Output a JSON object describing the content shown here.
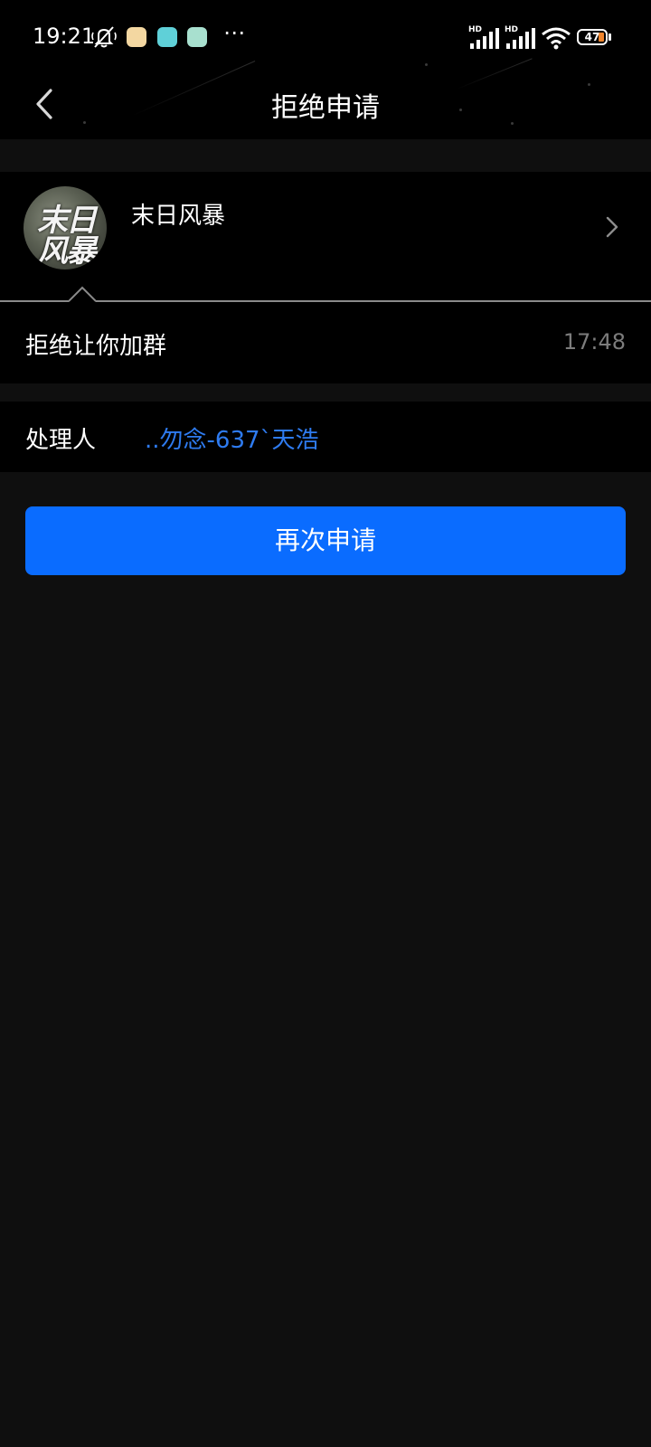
{
  "status_bar": {
    "time": "19:21",
    "hd_label": "HD",
    "battery_level": "47",
    "icons": [
      "mute-icon",
      "app-notification-icon",
      "app-notification-icon",
      "app-notification-icon",
      "more-icon",
      "signal-icon",
      "signal-icon",
      "wifi-icon",
      "battery-icon"
    ]
  },
  "nav": {
    "title": "拒绝申请",
    "back_icon": "chevron-left-icon"
  },
  "group": {
    "avatar_text_line1": "末日",
    "avatar_text_line2": "风暴",
    "name": "末日风暴",
    "chevron_icon": "chevron-right-icon"
  },
  "message": {
    "text": "拒绝让你加群",
    "time": "17:48"
  },
  "handler": {
    "label": "处理人",
    "name": "..勿念-637`天浩"
  },
  "actions": {
    "reapply_label": "再次申请"
  },
  "colors": {
    "background": "#0f0f0f",
    "panel": "#000000",
    "accent_blue": "#0a6cff",
    "link_blue": "#2e7bf0",
    "muted_text": "#7c7c7c"
  }
}
